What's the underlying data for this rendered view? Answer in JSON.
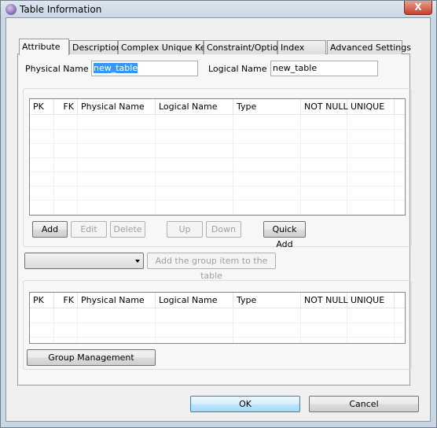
{
  "window": {
    "title": "Table Information",
    "close_symbol": "X"
  },
  "tabs": [
    {
      "label": "Attribute",
      "selected": true
    },
    {
      "label": "Description"
    },
    {
      "label": "Complex Unique Key"
    },
    {
      "label": "Constraint/Option"
    },
    {
      "label": "Index"
    },
    {
      "label": "Advanced Settings"
    }
  ],
  "form": {
    "physical_name_label": "Physical Name",
    "physical_name_value": "new_table",
    "logical_name_label": "Logical Name",
    "logical_name_value": "new_table"
  },
  "columns": [
    "PK",
    "FK",
    "Physical Name",
    "Logical Name",
    "Type",
    "NOT NULL",
    "UNIQUE"
  ],
  "buttons": {
    "add": "Add",
    "edit": "Edit",
    "delete": "Delete",
    "up": "Up",
    "down": "Down",
    "quick_add": "Quick Add",
    "add_group": "Add the group item to the table",
    "group_management": "Group Management",
    "ok": "OK",
    "cancel": "Cancel"
  },
  "group_combo": {
    "value": ""
  }
}
